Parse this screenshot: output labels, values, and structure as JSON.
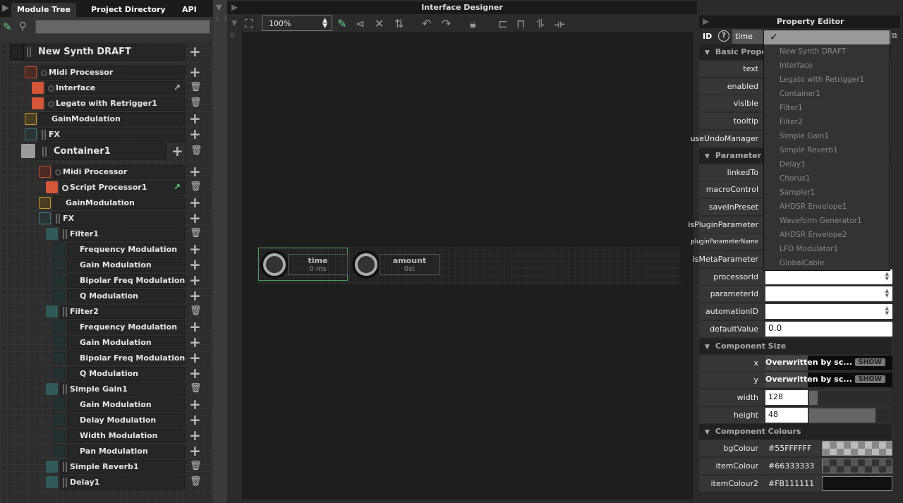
{
  "left_panel": {
    "tabs": [
      "Module Tree",
      "Project Directory",
      "API"
    ],
    "search_placeholder": ""
  },
  "tree": [
    {
      "label": "New Synth DRAFT",
      "level": 0,
      "kind": "root",
      "actions": [
        "add"
      ]
    },
    {
      "label": "Midi Processor",
      "level": 1,
      "kind": "midi",
      "actions": [
        "add"
      ]
    },
    {
      "label": "Interface",
      "level": 2,
      "kind": "script",
      "actions": [
        "open",
        "delete"
      ]
    },
    {
      "label": "Legato with Retrigger1",
      "level": 2,
      "kind": "script",
      "actions": [
        "delete"
      ]
    },
    {
      "label": "GainModulation",
      "level": 1,
      "kind": "gain",
      "actions": [
        "add"
      ]
    },
    {
      "label": "FX",
      "level": 1,
      "kind": "fx",
      "actions": [
        "add"
      ]
    },
    {
      "label": "Container1",
      "level": 0,
      "kind": "container",
      "actions": [
        "add",
        "delete"
      ]
    },
    {
      "label": "Midi Processor",
      "level": 3,
      "kind": "midi",
      "actions": [
        "add"
      ]
    },
    {
      "label": "Script Processor1",
      "level": 4,
      "kind": "script",
      "actions": [
        "open",
        "delete"
      ]
    },
    {
      "label": "GainModulation",
      "level": 3,
      "kind": "gain",
      "actions": [
        "add"
      ]
    },
    {
      "label": "FX",
      "level": 3,
      "kind": "fx",
      "actions": [
        "add"
      ]
    },
    {
      "label": "Filter1",
      "level": 4,
      "kind": "effect",
      "actions": [
        "delete"
      ]
    },
    {
      "label": "Frequency Modulation",
      "level": 5,
      "kind": "mod",
      "actions": [
        "add"
      ]
    },
    {
      "label": "Gain Modulation",
      "level": 5,
      "kind": "mod",
      "actions": [
        "add"
      ]
    },
    {
      "label": "Bipolar Freq Modulation",
      "level": 5,
      "kind": "mod",
      "actions": [
        "add"
      ]
    },
    {
      "label": "Q Modulation",
      "level": 5,
      "kind": "mod",
      "actions": [
        "add"
      ]
    },
    {
      "label": "Filter2",
      "level": 4,
      "kind": "effect",
      "actions": [
        "delete"
      ]
    },
    {
      "label": "Frequency Modulation",
      "level": 5,
      "kind": "mod",
      "actions": [
        "add"
      ]
    },
    {
      "label": "Gain Modulation",
      "level": 5,
      "kind": "mod",
      "actions": [
        "add"
      ]
    },
    {
      "label": "Bipolar Freq Modulation",
      "level": 5,
      "kind": "mod",
      "actions": [
        "add"
      ]
    },
    {
      "label": "Q Modulation",
      "level": 5,
      "kind": "mod",
      "actions": [
        "add"
      ]
    },
    {
      "label": "Simple Gain1",
      "level": 4,
      "kind": "effect",
      "actions": [
        "delete"
      ]
    },
    {
      "label": "Gain Modulation",
      "level": 5,
      "kind": "mod",
      "actions": [
        "add"
      ]
    },
    {
      "label": "Delay Modulation",
      "level": 5,
      "kind": "mod",
      "actions": [
        "add"
      ]
    },
    {
      "label": "Width Modulation",
      "level": 5,
      "kind": "mod",
      "actions": [
        "add"
      ]
    },
    {
      "label": "Pan Modulation",
      "level": 5,
      "kind": "mod",
      "actions": [
        "add"
      ]
    },
    {
      "label": "Simple Reverb1",
      "level": 4,
      "kind": "effect",
      "actions": [
        "delete"
      ]
    },
    {
      "label": "Delay1",
      "level": 4,
      "kind": "effect",
      "actions": [
        "delete"
      ]
    }
  ],
  "designer": {
    "title": "Interface Designer",
    "zoom": "100%",
    "components": [
      {
        "name": "time",
        "value": "0 ms",
        "selected": true
      },
      {
        "name": "amount",
        "value": "0st",
        "selected": false
      }
    ]
  },
  "property_editor": {
    "title": "Property Editor",
    "id_label": "ID",
    "id_value": "time",
    "dropdown": {
      "checked": "✓",
      "items": [
        "New Synth DRAFT",
        "Interface",
        "Legato with Retrigger1",
        "Container1",
        "Filter1",
        "Filter2",
        "Simple Gain1",
        "Simple Reverb1",
        "Delay1",
        "Chorus1",
        "Sampler1",
        "AHDSR Envelope1",
        "Waveform Generator1",
        "AHDSR Envelope2",
        "LFO Modulator1",
        "GlobalCable"
      ]
    },
    "rows": [
      {
        "section": "Basic Properties"
      },
      {
        "name": "text"
      },
      {
        "name": "enabled"
      },
      {
        "name": "visible"
      },
      {
        "name": "tooltip"
      },
      {
        "name": "useUndoManager"
      },
      {
        "section": "Parameter Properties"
      },
      {
        "name": "linkedTo"
      },
      {
        "name": "macroControl"
      },
      {
        "name": "saveInPreset"
      },
      {
        "name": "isPluginParameter"
      },
      {
        "name": "pluginParameterName"
      },
      {
        "name": "isMetaParameter"
      },
      {
        "name": "processorId",
        "type": "combo",
        "value": ""
      },
      {
        "name": "parameterId",
        "type": "combo",
        "value": ""
      },
      {
        "name": "automationID",
        "type": "combo",
        "value": ""
      },
      {
        "name": "defaultValue",
        "type": "text",
        "value": "0.0"
      },
      {
        "section": "Component Size"
      },
      {
        "name": "x",
        "type": "script",
        "value": "Overwritten by sc...",
        "button": "SHOW"
      },
      {
        "name": "y",
        "type": "script",
        "value": "Overwritten by sc...",
        "button": "SHOW"
      },
      {
        "name": "width",
        "type": "num",
        "value": "128",
        "fill": 0.1
      },
      {
        "name": "height",
        "type": "num",
        "value": "48",
        "fill": 0.8
      },
      {
        "section": "Component Colours"
      },
      {
        "name": "bgColour",
        "type": "colour",
        "value": "#55FFFFFF",
        "swatch": "#bbbbbb"
      },
      {
        "name": "itemColour",
        "type": "colour",
        "value": "#66333333",
        "swatch": "#555555"
      },
      {
        "name": "itemColour2",
        "type": "colour",
        "value": "#FB111111",
        "swatch": "#111111"
      }
    ]
  },
  "colors": {
    "script": "#d4573a",
    "midi_border": "#c0502f",
    "gain_border": "#c89a30",
    "fx_border": "#3d7a78",
    "effect": "#2f5a58",
    "accent_green": "#5fcf80"
  }
}
